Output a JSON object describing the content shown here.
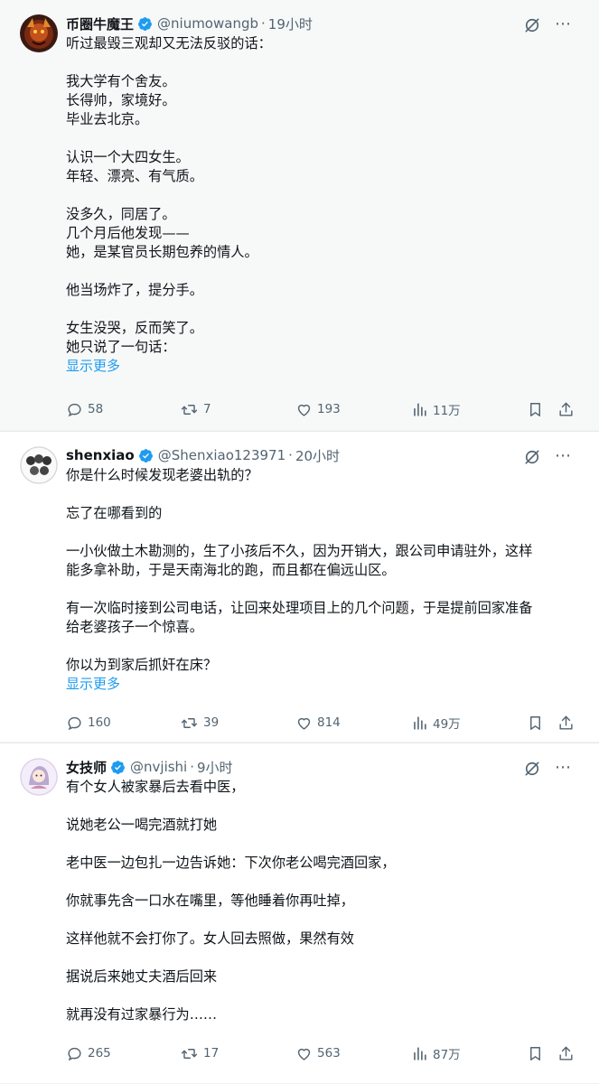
{
  "colors": {
    "link": "#1d9bf0",
    "muted": "#536471",
    "verified": "#1d9bf0"
  },
  "tweets": [
    {
      "name": "币圈牛魔王",
      "handle": "@niumowangb",
      "separator": "·",
      "time": "19小时",
      "lines": [
        [
          "听过最毁三观却又无法反驳的话："
        ],
        [
          "我大学有个舍友。",
          "长得帅，家境好。",
          "毕业去北京。"
        ],
        [
          "认识一个大四女生。",
          "年轻、漂亮、有气质。"
        ],
        [
          "没多久，同居了。",
          "几个月后他发现——",
          "她，是某官员长期包养的情人。"
        ],
        [
          "他当场炸了，提分手。"
        ],
        [
          "女生没哭，反而笑了。",
          "她只说了一句话："
        ]
      ],
      "show_more": "显示更多",
      "replies": "58",
      "retweets": "7",
      "likes": "193",
      "views": "11万"
    },
    {
      "name": "shenxiao",
      "handle": "@Shenxiao123971",
      "separator": "·",
      "time": "20小时",
      "lines": [
        [
          "你是什么时候发现老婆出轨的？"
        ],
        [
          "忘了在哪看到的"
        ],
        [
          "一小伙做土木勘测的，生了小孩后不久，因为开销大，跟公司申请驻外，这样",
          "能多拿补助，于是天南海北的跑，而且都在偏远山区。"
        ],
        [
          "有一次临时接到公司电话，让回来处理项目上的几个问题，于是提前回家准备",
          "给老婆孩子一个惊喜。"
        ],
        [
          "你以为到家后抓奸在床？"
        ]
      ],
      "show_more": "显示更多",
      "replies": "160",
      "retweets": "39",
      "likes": "814",
      "views": "49万"
    },
    {
      "name": "女技师",
      "handle": "@nvjishi",
      "separator": "·",
      "time": "9小时",
      "lines": [
        [
          "有个女人被家暴后去看中医，"
        ],
        [
          "说她老公一喝完酒就打她"
        ],
        [
          "老中医一边包扎一边告诉她：下次你老公喝完酒回家，"
        ],
        [
          "你就事先含一口水在嘴里，等他睡着你再吐掉，"
        ],
        [
          "这样他就不会打你了。女人回去照做，果然有效"
        ],
        [
          "据说后来她丈夫酒后回来"
        ],
        [
          "就再没有过家暴行为……"
        ]
      ],
      "show_more": "",
      "replies": "265",
      "retweets": "17",
      "likes": "563",
      "views": "87万"
    }
  ],
  "icons": {
    "verified": "verified-badge-icon",
    "grok": "grok-icon",
    "more": "more-options-icon",
    "reply": "reply-icon",
    "retweet": "retweet-icon",
    "like": "heart-icon",
    "views": "views-chart-icon",
    "bookmark": "bookmark-icon",
    "share": "share-icon"
  },
  "more_glyph": "⋯"
}
